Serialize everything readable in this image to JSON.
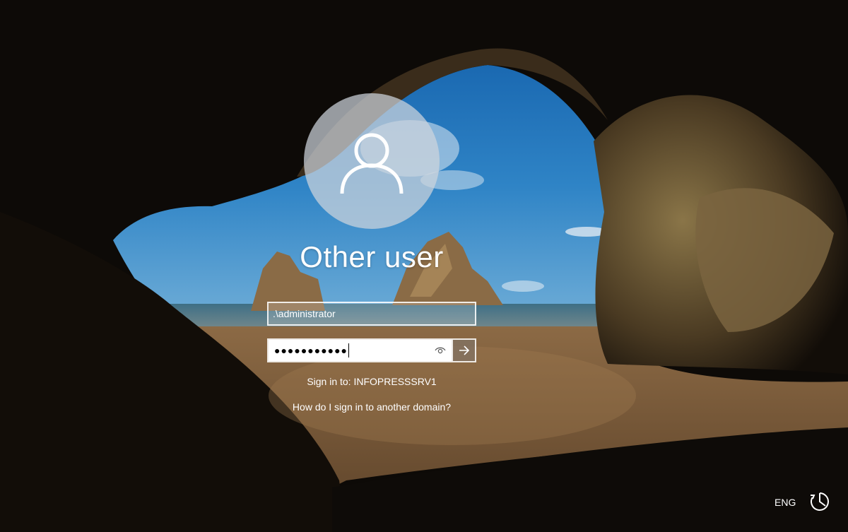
{
  "user": {
    "name": "Other user",
    "avatar_icon": "user-icon"
  },
  "form": {
    "username_value": ".\\administrator",
    "password_mask": "●●●●●●●●●●●",
    "reveal_icon": "eye-icon",
    "submit_icon": "arrow-right-icon"
  },
  "sign_in_to": "Sign in to: INFOPRESSSRV1",
  "help_link": "How do I sign in to another domain?",
  "system_tray": {
    "language": "ENG",
    "accessibility_icon": "ease-of-access-icon"
  },
  "colors": {
    "text": "#ffffff",
    "avatar_bg": "#cdd4dc",
    "submit_bg": "#827364"
  }
}
